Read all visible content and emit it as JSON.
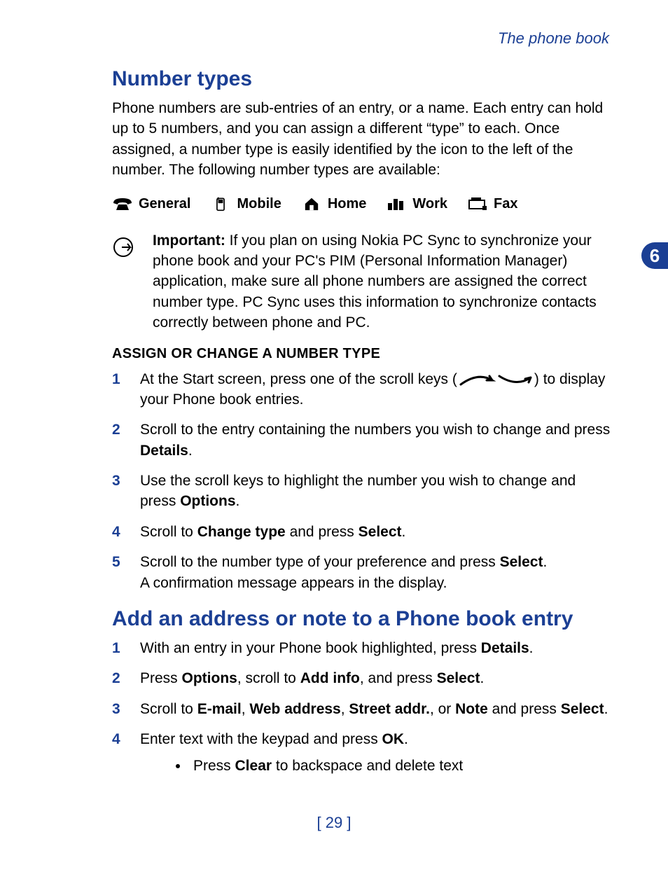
{
  "running_head": "The phone book",
  "side_tab": "6",
  "page_number": "[ 29 ]",
  "section1": {
    "heading": "Number types",
    "intro": "Phone numbers are sub-entries of an entry, or a name. Each entry can hold up to 5 numbers, and you can assign a different “type” to each. Once assigned, a number type is easily identified by the icon to the left of the number. The following number types are available:",
    "types": {
      "general": "General",
      "mobile": "Mobile",
      "home": "Home",
      "work": "Work",
      "fax": "Fax"
    },
    "important_label": "Important:",
    "important_text": " If you plan on using Nokia PC Sync to synchronize your phone book and your PC's PIM (Personal Information Manager) application, make sure all phone numbers are assigned the correct number type. PC Sync uses this information to synchronize contacts correctly between phone and PC.",
    "assign_heading": "ASSIGN OR CHANGE A NUMBER TYPE",
    "steps": {
      "s1a": "At the Start screen, press one of the scroll keys (",
      "s1b": ") to display your Phone book entries.",
      "s2a": "Scroll to the entry containing the numbers you wish to change and press ",
      "s2b": "Details",
      "s2c": ".",
      "s3a": "Use the scroll keys to highlight the number you wish to change and press ",
      "s3b": "Options",
      "s3c": ".",
      "s4a": "Scroll to ",
      "s4b": "Change type",
      "s4c": " and press ",
      "s4d": "Select",
      "s4e": ".",
      "s5a": "Scroll to the number type of your preference and press ",
      "s5b": "Select",
      "s5c": ".",
      "s5d": "A confirmation message appears in the display."
    }
  },
  "section2": {
    "heading": "Add an address or note to a Phone book entry",
    "steps": {
      "s1a": "With an entry in your Phone book highlighted, press ",
      "s1b": "Details",
      "s1c": ".",
      "s2a": "Press ",
      "s2b": "Options",
      "s2c": ", scroll to ",
      "s2d": "Add info",
      "s2e": ", and press ",
      "s2f": "Select",
      "s2g": ".",
      "s3a": "Scroll to ",
      "s3b": "E-mail",
      "s3c": ", ",
      "s3d": "Web address",
      "s3e": ", ",
      "s3f": "Street addr.",
      "s3g": ", or ",
      "s3h": "Note",
      "s3i": " and press ",
      "s3j": "Select",
      "s3k": ".",
      "s4a": "Enter text with the keypad and press ",
      "s4b": "OK",
      "s4c": ".",
      "bullet_a": "Press ",
      "bullet_b": "Clear",
      "bullet_c": " to backspace and delete text"
    }
  }
}
